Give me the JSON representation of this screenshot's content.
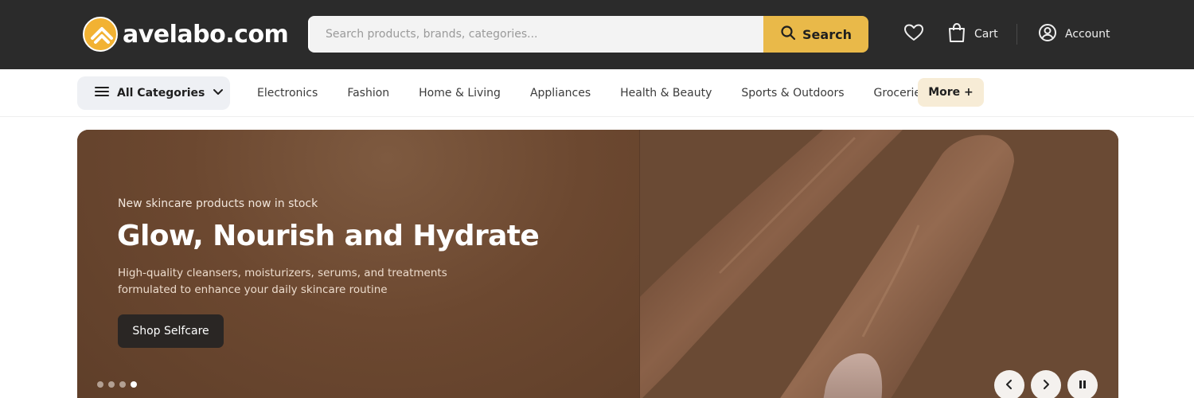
{
  "brand": {
    "name": "avelabo.com",
    "accent": "#e9b949"
  },
  "search": {
    "placeholder": "Search products, brands, categories...",
    "button_label": "Search"
  },
  "header_actions": {
    "cart_label": "Cart",
    "account_label": "Account"
  },
  "categories": {
    "all_label": "All Categories",
    "items": [
      "Electronics",
      "Fashion",
      "Home & Living",
      "Appliances",
      "Health & Beauty",
      "Sports & Outdoors",
      "Groceries"
    ],
    "more_label": "More +"
  },
  "hero": {
    "eyebrow": "New skincare products now in stock",
    "headline": "Glow, Nourish and Hydrate",
    "subtext": "High-quality cleansers, moisturizers, serums, and treatments formulated to enhance your daily skincare routine",
    "cta_label": "Shop Selfcare",
    "slide_count": 4,
    "active_slide": 4
  },
  "icons": [
    "logo-icon",
    "search-icon",
    "heart-icon",
    "cart-icon",
    "account-icon",
    "menu-icon",
    "chevron-down-icon",
    "chevron-left-icon",
    "chevron-right-icon",
    "pause-icon"
  ]
}
